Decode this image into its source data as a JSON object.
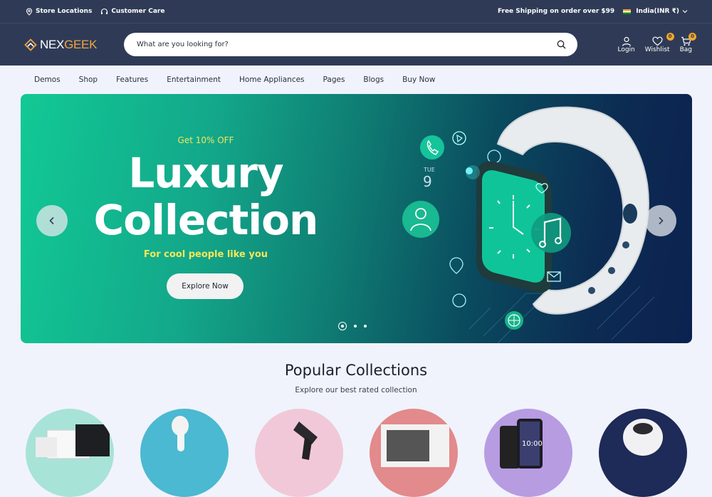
{
  "topbar": {
    "store_locations": "Store Locations",
    "customer_care": "Customer Care",
    "shipping": "Free Shipping on order over $99",
    "currency": "India(INR ₹)"
  },
  "header": {
    "logo_prefix": "NEX",
    "logo_suffix": "GEEK",
    "search_placeholder": "What are you looking for?",
    "login": "Login",
    "wishlist": "Wishlist",
    "wishlist_count": "0",
    "bag": "Bag",
    "bag_count": "0"
  },
  "nav": [
    "Demos",
    "Shop",
    "Features",
    "Entertainment",
    "Home Appliances",
    "Pages",
    "Blogs",
    "Buy Now"
  ],
  "hero": {
    "offer": "Get 10% OFF",
    "title_line1": "Luxury",
    "title_line2": "Collection",
    "subtitle": "For cool people like you",
    "cta": "Explore Now",
    "watch_day": "TUE",
    "watch_date": "9",
    "slide_count": 3,
    "active_slide": 1
  },
  "collections": {
    "title": "Popular Collections",
    "subtitle": "Explore our best rated collection",
    "screen_time": "10:00"
  },
  "colors": {
    "header_bg": "#2f3b56",
    "accent": "#f4a62a",
    "hero_highlight": "#f4e65a"
  }
}
